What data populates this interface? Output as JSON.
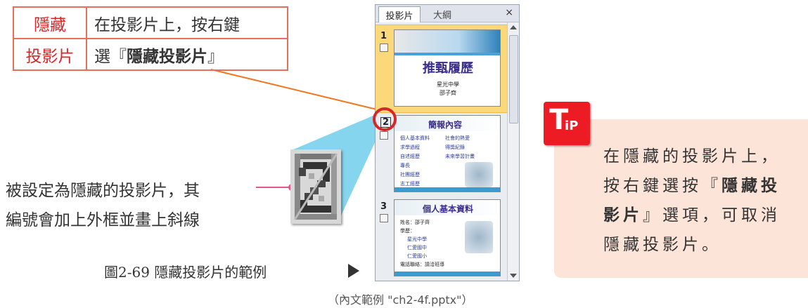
{
  "table": {
    "r1_left": "隱藏",
    "r1_right": "在投影片上，按右鍵",
    "r2_left": "投影片",
    "r2_right_pre": "選『",
    "r2_right_bold": "隱藏投影片",
    "r2_right_post": "』"
  },
  "note": {
    "line1": "被設定為隱藏的投影片，其",
    "line2": "編號會加上外框並畫上斜線"
  },
  "caption": "圖2-69 隱藏投影片的範例",
  "source": "（內文範例 \"ch2-4f.pptx\"）",
  "panel": {
    "tab1": "投影片",
    "tab2": "大綱",
    "close": "×",
    "slides": [
      {
        "num": "1",
        "title": "推甄履歷",
        "sub1": "星光中學",
        "sub2": "邵子齊"
      },
      {
        "num": "2",
        "title": "簡報內容",
        "items": [
          "個人基本資料",
          "求學過程",
          "自述經歷",
          "專長",
          "社團經歷",
          "志工經歷",
          "社會的熱愛",
          "得獎紀錄",
          "未來學習計畫"
        ]
      },
      {
        "num": "3",
        "title": "個人基本資料",
        "items": [
          "姓名：邵子齊",
          "學歷：",
          "星光中學",
          "仁愛國中",
          "仁愛國小",
          "電話聯絡：請洽班導"
        ]
      }
    ]
  },
  "tip": {
    "icon_letter": "T",
    "icon_small": "iP",
    "line1": "在隱藏的投影片上，",
    "line2_pre": "按右鍵選按『",
    "line2_bold": "隱藏投",
    "line3_bold": "影片",
    "line3_post": "』選項，可取消",
    "line4": "隱藏投影片。"
  },
  "colors": {
    "accent_red": "#d7262a",
    "table_border": "#e8705a",
    "tip_bg": "#fce4d9",
    "tip_icon": "#ed1c24",
    "pink_line": "#e05a8a",
    "orange_line": "#f07820",
    "selection": "#fbd97a"
  }
}
